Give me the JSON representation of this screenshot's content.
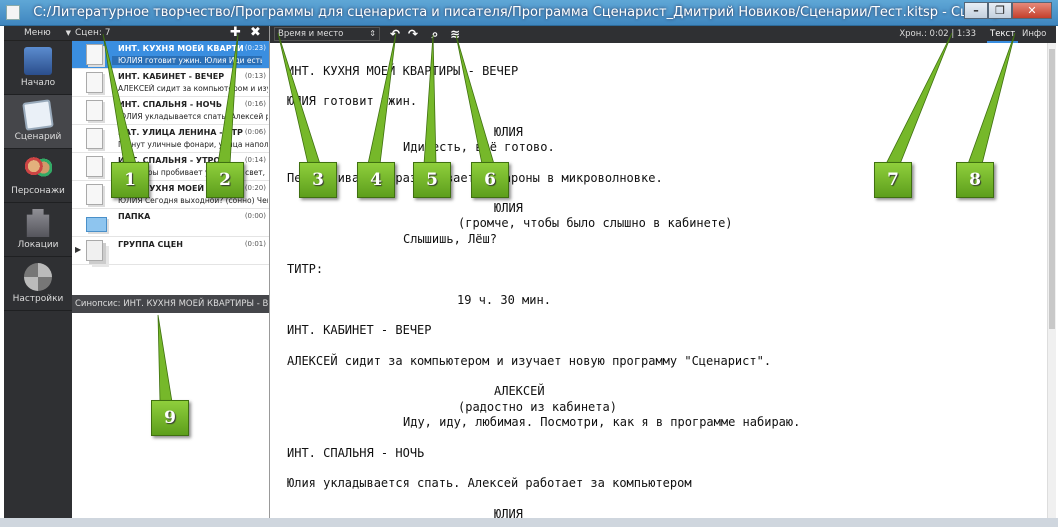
{
  "window": {
    "title": "C:/Литературное творчество/Программы для сценариста и писателя/Программа Сценарист_Дмитрий Новиков/Сценарии/Тест.kitsp  - Сценарист",
    "minimize": "–",
    "restore": "❐",
    "close": "✕"
  },
  "nav": {
    "menu_label": "Меню",
    "menu_caret": "▼",
    "items": [
      {
        "label": "Начало",
        "icon": "books-icon"
      },
      {
        "label": "Сценарий",
        "icon": "script-scroll-icon"
      },
      {
        "label": "Персонажи",
        "icon": "characters-icon"
      },
      {
        "label": "Локации",
        "icon": "castle-icon"
      },
      {
        "label": "Настройки",
        "icon": "tools-icon"
      }
    ]
  },
  "scenes": {
    "label": "Сцен:",
    "count": "7",
    "add": "✚",
    "remove": "✖",
    "items": [
      {
        "title": "ИНТ. КУХНЯ МОЕЙ КВАРТИРЫ - ВЕЧЕР",
        "duration": "(0:23)",
        "desc": "ЮЛИЯ готовит ужин. Юлия Иди есть, всё готово."
      },
      {
        "title": "ИНТ. КАБИНЕТ - ВЕЧЕР",
        "duration": "(0:13)",
        "desc": "АЛЕКСЕЙ сидит за компьютером и изучает новую"
      },
      {
        "title": "ИНТ. СПАЛЬНЯ - НОЧЬ",
        "duration": "(0:16)",
        "desc": "ЮЛИЯ укладывается спать. Алексей работает"
      },
      {
        "title": "НАТ. УЛИЦА ЛЕНИНА - УТРО",
        "duration": "(0:06)",
        "desc": "Гаснут уличные фонари, улица наполняется"
      },
      {
        "title": "ИНТ. СПАЛЬНЯ - УТРО",
        "duration": "(0:14)",
        "desc": "Мониторы пробивает утренний свет, рас..."
      },
      {
        "title": "ИНТ. КУХНЯ МОЕЙ КВАРТИРЫ",
        "duration": "(0:20)",
        "desc": "ЮЛИЯ Сегодня выходной? (сонно) Чем"
      },
      {
        "title": "ПАПКА",
        "duration": "(0:00)",
        "desc": ""
      },
      {
        "title": "ГРУППА СЦЕН",
        "duration": "(0:01)",
        "desc": ""
      }
    ],
    "synopsis": "Синопсис: ИНТ. КУХНЯ МОЕЙ КВАРТИРЫ - ВЕЧЕР"
  },
  "editor_toolbar": {
    "type_select": "Время и место",
    "type_arrow": "⇕",
    "undo": "↶",
    "redo": "↷",
    "search": "⌕",
    "layers": "≋",
    "chron": "Хрон.: 0:02 | 1:33",
    "tab_text": "Текст",
    "tab_info": "Инфо"
  },
  "script_lines": [
    "ИНТ. КУХНЯ МОЕЙ КВАРТИРЫ - ВЕЧЕР",
    "ЮЛИЯ готовит ужин.",
    "ЮЛИЯ",
    "Иди есть, всё готово.",
    "Перемешивает и разогревает макароны в микроволновке.",
    "ЮЛИЯ",
    "(громче, чтобы было слышно в кабинете)",
    "Слышишь, Лёш?",
    "ТИТР:",
    "19 ч. 30 мин.",
    "ИНТ. КАБИНЕТ - ВЕЧЕР",
    "АЛЕКСЕЙ сидит за компьютером и изучает новую программу \"Сценарист\".",
    "АЛЕКСЕЙ",
    "(радостно из кабинета)",
    "Иду, иду, любимая. Посмотри, как я в программе набираю.",
    "ИНТ. СПАЛЬНЯ - НОЧЬ",
    "Юлия укладывается спать. Алексей работает за компьютером",
    "ЮЛИЯ"
  ],
  "callouts": [
    "1",
    "2",
    "3",
    "4",
    "5",
    "6",
    "7",
    "8",
    "9"
  ]
}
